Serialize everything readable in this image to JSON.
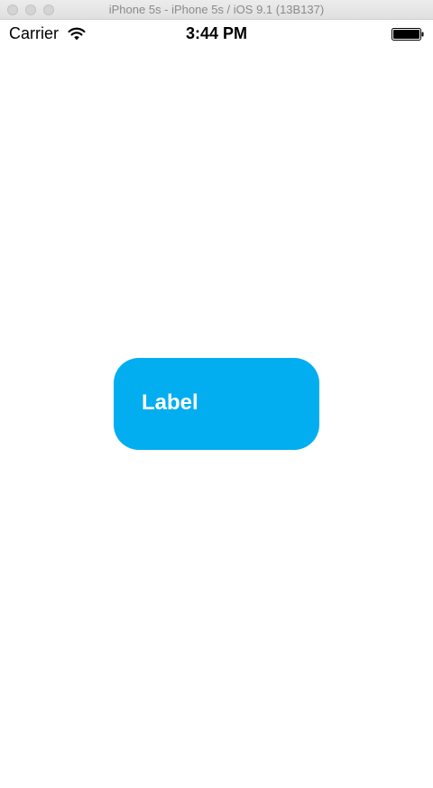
{
  "window": {
    "title": "iPhone 5s - iPhone 5s / iOS 9.1 (13B137)"
  },
  "status_bar": {
    "carrier": "Carrier",
    "time": "3:44 PM",
    "wifi_icon": "wifi-icon",
    "battery_icon": "battery-icon",
    "battery_level": 1.0
  },
  "content": {
    "label": "Label",
    "label_background": "#03aef0",
    "label_text_color": "#ffffff"
  }
}
